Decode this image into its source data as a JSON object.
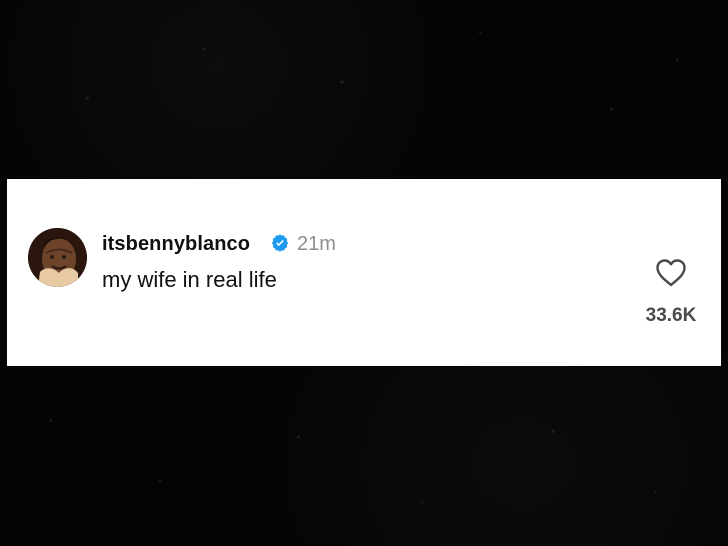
{
  "post": {
    "username": "itsbennyblanco",
    "timestamp": "21m",
    "text": "my wife in real life",
    "likes": "33.6K",
    "verified": true
  },
  "icons": {
    "verified": "verified-badge-icon",
    "like": "heart-icon"
  },
  "colors": {
    "verified": "#1D9BF0",
    "card_background": "#FFFFFF",
    "page_background": "#050505",
    "timestamp": "#8E8E8E",
    "likes": "#4A4A4A"
  }
}
